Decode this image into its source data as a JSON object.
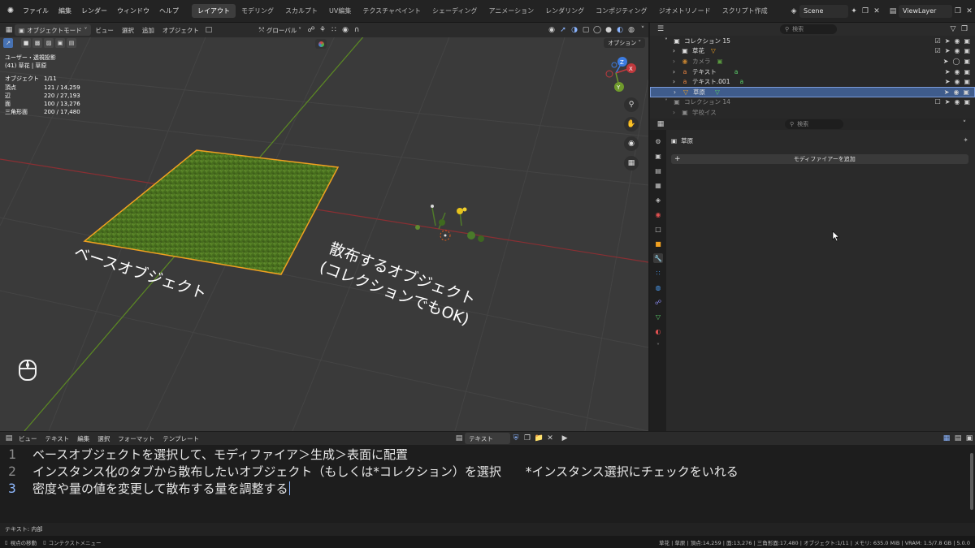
{
  "menu": {
    "items": [
      "ファイル",
      "編集",
      "レンダー",
      "ウィンドウ",
      "ヘルプ"
    ]
  },
  "workspaces": {
    "tabs": [
      "レイアウト",
      "モデリング",
      "スカルプト",
      "UV編集",
      "テクスチャペイント",
      "シェーディング",
      "アニメーション",
      "レンダリング",
      "コンポジティング",
      "ジオメトリノード",
      "スクリプト作成"
    ],
    "active_index": 0
  },
  "scene": {
    "scene_name": "Scene",
    "view_layer": "ViewLayer"
  },
  "viewport": {
    "mode_label": "オブジェクトモード",
    "menus": [
      "ビュー",
      "選択",
      "追加",
      "オブジェクト"
    ],
    "orientation": "グローバル",
    "options_label": "オプション",
    "view_name": "ユーザー・透視投影",
    "object_context": "(41) 草花 | 草原",
    "stats": [
      {
        "label": "オブジェクト",
        "value": "1/11"
      },
      {
        "label": "頂点",
        "value": "121 / 14,259"
      },
      {
        "label": "辺",
        "value": "220 / 27,193"
      },
      {
        "label": "面",
        "value": "100 / 13,276"
      },
      {
        "label": "三角形面",
        "value": "200 / 17,480"
      }
    ],
    "annotation_base": "ベースオブジェクト",
    "annotation_scatter_1": "散布するオブジェクト",
    "annotation_scatter_2": "(コレクションでもOK)",
    "gizmo_axes": {
      "x": "X",
      "y": "Y",
      "z": "Z"
    }
  },
  "outliner": {
    "search_placeholder": "検索",
    "rows": [
      {
        "label": "コレクション 15",
        "icon": "collection-icon",
        "level": 0,
        "selected": false,
        "dim": false
      },
      {
        "label": "草花",
        "icon": "mesh-icon",
        "level": 1,
        "selected": false,
        "dim": false
      },
      {
        "label": "カメラ",
        "icon": "camera-icon",
        "level": 1,
        "selected": false,
        "dim": true
      },
      {
        "label": "テキスト",
        "icon": "text-icon",
        "level": 1,
        "selected": false,
        "dim": false
      },
      {
        "label": "テキスト.001",
        "icon": "text-icon",
        "level": 1,
        "selected": false,
        "dim": false
      },
      {
        "label": "草原",
        "icon": "mesh-icon",
        "level": 1,
        "selected": true,
        "dim": false
      },
      {
        "label": "コレクション 14",
        "icon": "collection-icon",
        "level": 0,
        "selected": false,
        "dim": true
      },
      {
        "label": "学校イス",
        "icon": "mesh-icon",
        "level": 1,
        "selected": false,
        "dim": true
      }
    ]
  },
  "properties": {
    "search_placeholder": "検索",
    "object_name": "草原",
    "add_modifier_label": "モディファイアーを追加"
  },
  "text_editor": {
    "menus": [
      "ビュー",
      "テキスト",
      "編集",
      "選択",
      "フォーマット",
      "テンプレート"
    ],
    "datablock_name": "テキスト",
    "lines": [
      {
        "number": "1",
        "text": "ベースオブジェクトを選択して、モディファイア＞生成＞表面に配置"
      },
      {
        "number": "2",
        "text": "インスタンス化のタブから散布したいオブジェクト（もしくは*コレクション）を選択　　*インスタンス選択にチェックをいれる"
      },
      {
        "number": "3",
        "text": "密度や量の値を変更して散布する量を調整する"
      }
    ],
    "current_line": 3,
    "footer": "テキスト: 内部"
  },
  "statusbar": {
    "left_1": "視点の移動",
    "left_2": "コンテクストメニュー",
    "right": "草花 | 草原 | 頂点:14,259 | 面:13,276 | 三角形面:17,480 | オブジェクト:1/11 | メモリ: 635.0 MiB | VRAM: 1.5/7.8 GB | 5.0.0"
  },
  "colors": {
    "accent": "#4772b3",
    "selection_outline": "#f0a020",
    "x_axis": "#c0393d",
    "y_axis": "#6f9a2c",
    "z_axis": "#3c7be0"
  }
}
